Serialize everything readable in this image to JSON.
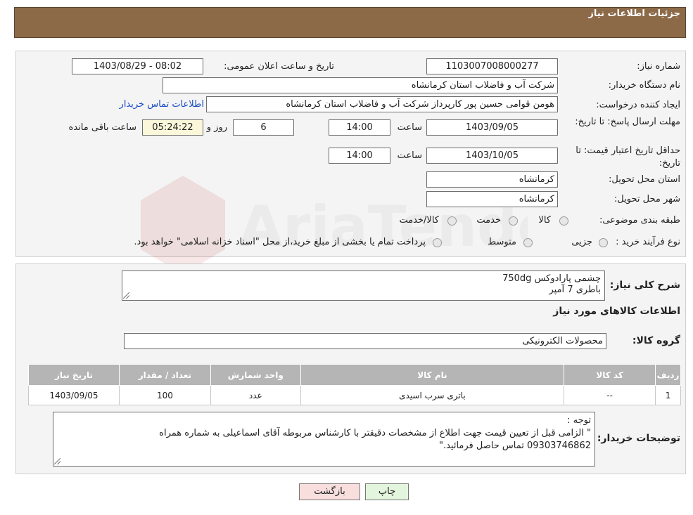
{
  "header": {
    "title": "جزئیات اطلاعات نیاز"
  },
  "form": {
    "need_number_label": "شماره نیاز:",
    "need_number": "1103007008000277",
    "announce_label": "تاریخ و ساعت اعلان عمومی:",
    "announce_value": "1403/08/29 - 08:02",
    "buyer_org_label": "نام دستگاه خریدار:",
    "buyer_org": "شرکت آب و فاضلاب استان کرمانشاه",
    "creator_label": "ایجاد کننده درخواست:",
    "creator": "هومن قوامی حسین پور کارپرداز شرکت آب و فاضلاب استان کرمانشاه",
    "contact_link": "اطلاعات تماس خریدار",
    "deadline_label": "مهلت ارسال پاسخ: تا تاریخ:",
    "deadline_date": "1403/09/05",
    "time_label": "ساعت",
    "deadline_time": "14:00",
    "days_value": "6",
    "days_label": "روز و",
    "remaining_time": "05:24:22",
    "remaining_label": "ساعت باقی مانده",
    "validity_label": "حداقل تاریخ اعتبار قیمت: تا تاریخ:",
    "validity_date": "1403/10/05",
    "validity_time": "14:00",
    "province_label": "استان محل تحویل:",
    "province": "کرمانشاه",
    "city_label": "شهر محل تحویل:",
    "city": "کرمانشاه",
    "category_label": "طبقه بندی موضوعی:",
    "category_options": [
      "کالا",
      "خدمت",
      "کالا/خدمت"
    ],
    "process_label": "نوع فرآیند خرید :",
    "process_options": [
      "جزیی",
      "متوسط"
    ],
    "process_note": "پرداخت تمام یا بخشی از مبلغ خرید،از محل \"اسناد خزانه اسلامی\" خواهد بود."
  },
  "details": {
    "description_label": "شرح کلی نیاز:",
    "description_lines": [
      "چشمی پارادوکس 750dg",
      "باطری 7 آمپر"
    ],
    "goods_info_title": "اطلاعات کالاهای مورد نیاز",
    "goods_group_label": "گروه کالا:",
    "goods_group": "محصولات الکترونیکی",
    "table": {
      "headers": [
        "ردیف",
        "کد کالا",
        "نام کالا",
        "واحد شمارش",
        "تعداد / مقدار",
        "تاریخ نیاز"
      ],
      "rows": [
        [
          "1",
          "--",
          "باتری سرب اسیدی",
          "عدد",
          "100",
          "1403/09/05"
        ]
      ]
    },
    "buyer_notes_label": "توضیحات خریدار:",
    "buyer_notes_lines": [
      "توجه :",
      "\" الزامی قبل از تعیین قیمت جهت اطلاع از مشخصات دقیقتر با کارشناس مربوطه آقای اسماعیلی به شماره همراه",
      "09303746862 تماس حاصل فرمائید.\""
    ]
  },
  "buttons": {
    "print": "چاپ",
    "back": "بازگشت"
  },
  "watermark": {
    "text": "AriaTender.neT"
  },
  "colors": {
    "header_bg": "#8c6a48",
    "link": "#1a4cc7",
    "back_button_bg": "#f9dede",
    "print_button_bg": "#e3f5dc",
    "yellow_field": "#fbf7da"
  }
}
